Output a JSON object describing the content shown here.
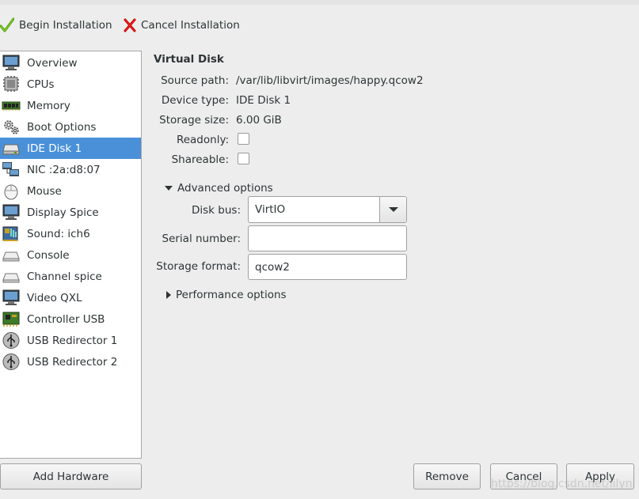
{
  "toolbar": {
    "begin_label": "Begin Installation",
    "cancel_label": "Cancel Installation"
  },
  "sidebar": {
    "items": [
      {
        "label": "Overview",
        "icon": "monitor-icon"
      },
      {
        "label": "CPUs",
        "icon": "cpu-chip-icon"
      },
      {
        "label": "Memory",
        "icon": "memory-module-icon"
      },
      {
        "label": "Boot Options",
        "icon": "gears-icon"
      },
      {
        "label": "IDE Disk 1",
        "icon": "hard-disk-icon",
        "selected": true
      },
      {
        "label": "NIC :2a:d8:07",
        "icon": "network-icon"
      },
      {
        "label": "Mouse",
        "icon": "mouse-icon"
      },
      {
        "label": "Display Spice",
        "icon": "display-monitor-icon"
      },
      {
        "label": "Sound: ich6",
        "icon": "sound-card-icon"
      },
      {
        "label": "Console",
        "icon": "serial-port-icon"
      },
      {
        "label": "Channel spice",
        "icon": "channel-port-icon"
      },
      {
        "label": "Video QXL",
        "icon": "video-monitor-icon"
      },
      {
        "label": "Controller USB",
        "icon": "controller-card-icon"
      },
      {
        "label": "USB Redirector 1",
        "icon": "usb-icon"
      },
      {
        "label": "USB Redirector 2",
        "icon": "usb-icon"
      }
    ],
    "add_hardware_label": "Add Hardware"
  },
  "details": {
    "title": "Virtual Disk",
    "source_path_label": "Source path:",
    "source_path": "/var/lib/libvirt/images/happy.qcow2",
    "device_type_label": "Device type:",
    "device_type": "IDE Disk 1",
    "storage_size_label": "Storage size:",
    "storage_size": "6.00 GiB",
    "readonly_label": "Readonly:",
    "readonly_checked": false,
    "shareable_label": "Shareable:",
    "shareable_checked": false,
    "advanced_label": "Advanced options",
    "disk_bus_label": "Disk bus:",
    "disk_bus_value": "VirtIO",
    "serial_label": "Serial number:",
    "serial_value": "",
    "storage_format_label": "Storage format:",
    "storage_format_value": "qcow2",
    "performance_label": "Performance options"
  },
  "buttons": {
    "remove": "Remove",
    "cancel": "Cancel",
    "apply": "Apply"
  },
  "watermark": "https://blog.csdn.net/lilyn",
  "colors": {
    "selection": "#4a90d9",
    "window_bg": "#ededed",
    "check_green": "#4e9a06",
    "cancel_red": "#cc0000"
  }
}
